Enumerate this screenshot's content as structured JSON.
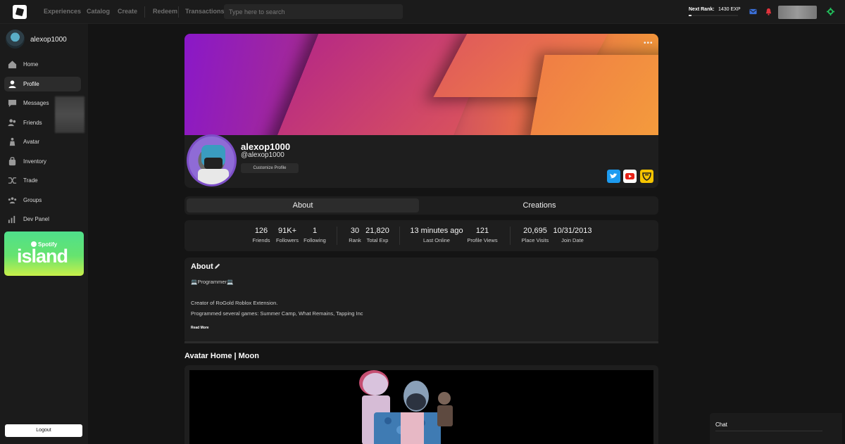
{
  "topbar": {
    "nav": [
      "Experiences",
      "Catalog",
      "Create",
      "Redeem",
      "Transactions"
    ],
    "search_placeholder": "Type here to search",
    "next_rank_label": "Next Rank:",
    "exp_label": "1430 EXP",
    "rank_progress": 0.05
  },
  "sidebar": {
    "username": "alexop1000",
    "items": [
      {
        "label": "Home",
        "icon": "home-icon"
      },
      {
        "label": "Profile",
        "icon": "profile-icon"
      },
      {
        "label": "Messages",
        "icon": "messages-icon"
      },
      {
        "label": "Friends",
        "icon": "friends-icon"
      },
      {
        "label": "Avatar",
        "icon": "avatar-icon"
      },
      {
        "label": "Inventory",
        "icon": "inventory-icon"
      },
      {
        "label": "Trade",
        "icon": "trade-icon"
      },
      {
        "label": "Groups",
        "icon": "groups-icon"
      },
      {
        "label": "Dev Panel",
        "icon": "dev-panel-icon"
      }
    ],
    "active_item": "Profile",
    "ad": {
      "brand": "Spotify",
      "title": "island"
    },
    "logout_label": "Logout"
  },
  "profile": {
    "display_name": "alexop1000",
    "handle": "@alexop1000",
    "customize_label": "Customize Profile",
    "more_label": "•••",
    "socials": [
      {
        "name": "twitter",
        "color": "#1d9bf0"
      },
      {
        "name": "youtube",
        "color": "#ffffff"
      },
      {
        "name": "guilded",
        "color": "#f5c400"
      }
    ]
  },
  "tabs": [
    {
      "label": "About",
      "active": true
    },
    {
      "label": "Creations",
      "active": false
    }
  ],
  "stats": [
    {
      "value": "126",
      "label": "Friends"
    },
    {
      "value": "91K+",
      "label": "Followers"
    },
    {
      "value": "1",
      "label": "Following"
    },
    {
      "value": "30",
      "label": "Rank"
    },
    {
      "value": "21,820",
      "label": "Total Exp"
    },
    {
      "value": "13 minutes ago",
      "label": "Last Online"
    },
    {
      "value": "121",
      "label": "Profile Views"
    },
    {
      "value": "20,695",
      "label": "Place Visits"
    },
    {
      "value": "10/31/2013",
      "label": "Join Date"
    }
  ],
  "about": {
    "title": "About",
    "lines": [
      "💻Programmer💻",
      "Creator of RoGold Roblox Extension.",
      "Programmed several games: Summer Camp, What Remains, Tapping Inc"
    ],
    "read_more": "Read More"
  },
  "avatar_home": {
    "title": "Avatar Home | Moon"
  },
  "chat": {
    "label": "Chat"
  },
  "colors": {
    "background": "#141414",
    "panel": "#1e1e1e",
    "accent_green": "#22c55e"
  }
}
